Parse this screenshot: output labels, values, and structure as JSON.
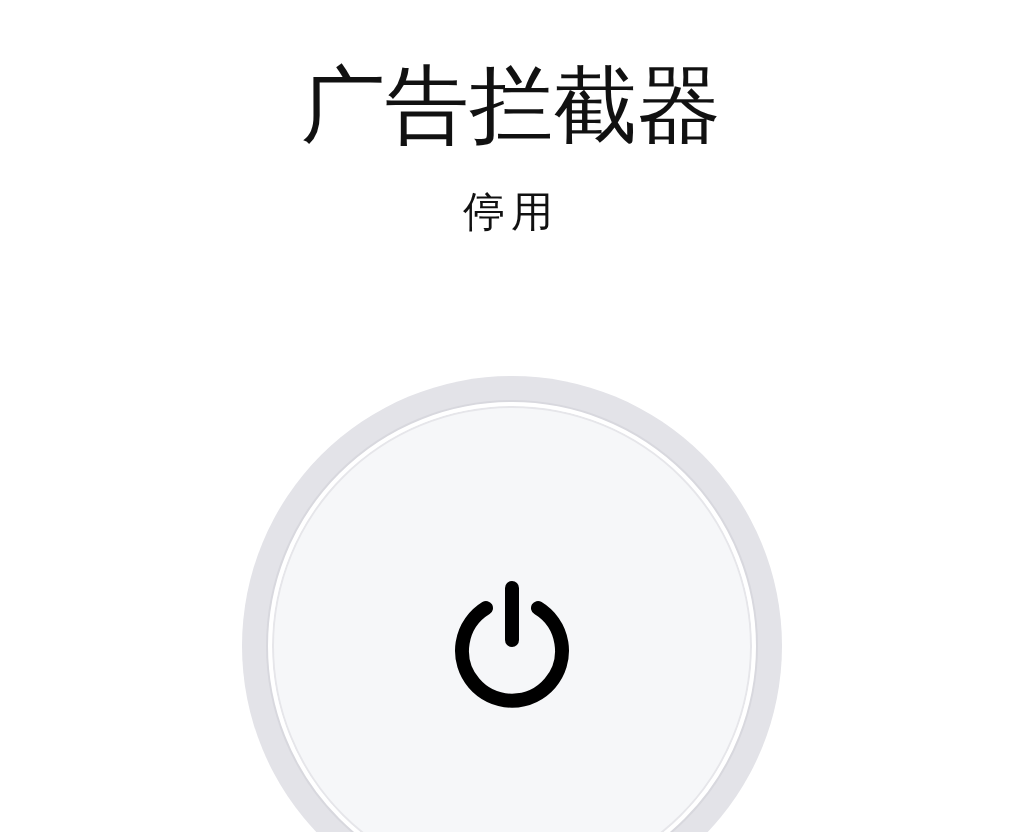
{
  "title": "广告拦截器",
  "status": "停用",
  "power_button": {
    "on": false
  }
}
